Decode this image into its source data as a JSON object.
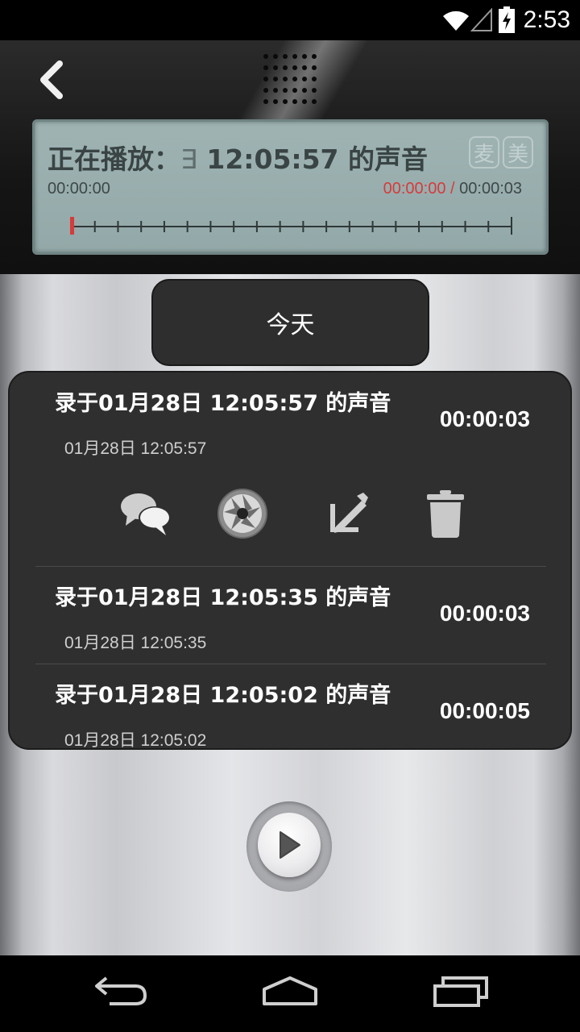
{
  "status_bar": {
    "time": "2:53",
    "icons": [
      "wifi-icon",
      "signal-icon",
      "battery-charging-icon"
    ]
  },
  "header": {
    "back_icon": "back-chevron-icon",
    "speaker_icon": "speaker-grille-icon"
  },
  "lcd": {
    "title_prefix": "正在播放：",
    "title_cursor": "∃",
    "title_main": "12:05:57 的声音",
    "badges": [
      "麦",
      "美"
    ],
    "start_time": "00:00:00",
    "current_time": "00:00:00",
    "separator": "/",
    "total_time": "00:00:03",
    "progress": 0.0
  },
  "date_tab": {
    "label": "今天"
  },
  "recordings": [
    {
      "title": "录于01月28日 12:05:57 的声音",
      "date": "01月28日 12:05:57",
      "duration": "00:00:03",
      "expanded": true
    },
    {
      "title": "录于01月28日 12:05:35 的声音",
      "date": "01月28日 12:05:35",
      "duration": "00:00:03",
      "expanded": false
    },
    {
      "title": "录于01月28日 12:05:02 的声音",
      "date": "01月28日 12:05:02",
      "duration": "00:00:05",
      "expanded": false
    }
  ],
  "actions": [
    "share-chat-icon",
    "aperture-icon",
    "edit-pencil-icon",
    "trash-icon"
  ],
  "player": {
    "play_icon": "play-icon"
  },
  "nav": [
    "back-nav-icon",
    "home-nav-icon",
    "recents-nav-icon"
  ]
}
